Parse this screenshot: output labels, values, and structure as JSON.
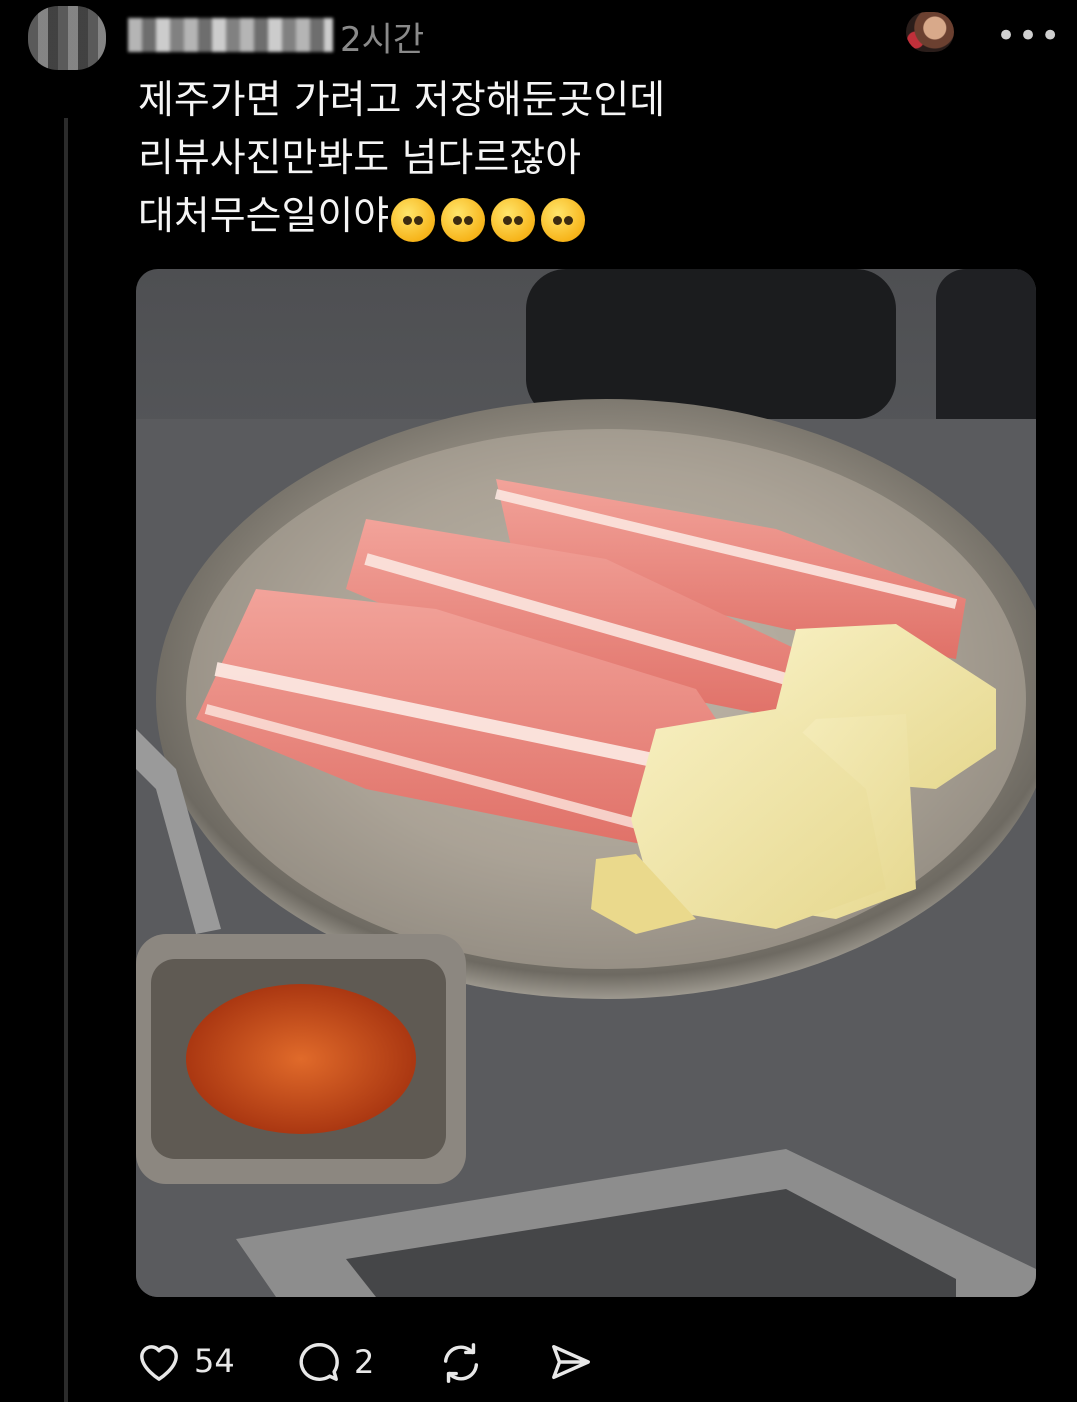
{
  "post": {
    "timestamp": "2시간",
    "more_label": "•••",
    "lines": [
      "제주가면 가려고 저장해둔곳인데",
      "리뷰사진만봐도 넘다르잖아",
      "대처무슨일이야"
    ],
    "emojis": [
      "flushed-face",
      "flushed-face",
      "flushed-face",
      "flushed-face"
    ]
  },
  "image": {
    "subject": "raw pork belly slices with sliced potatoes on a metal plate, side dish of red paste"
  },
  "actions": {
    "likes": "54",
    "comments": "2"
  },
  "icons": {
    "like": "heart-icon",
    "comment": "comment-icon",
    "repost": "repost-icon",
    "share": "send-icon",
    "more": "more-icon"
  },
  "colors": {
    "background": "#000000",
    "text": "#f5f5f5",
    "muted": "#8a8a8a"
  }
}
